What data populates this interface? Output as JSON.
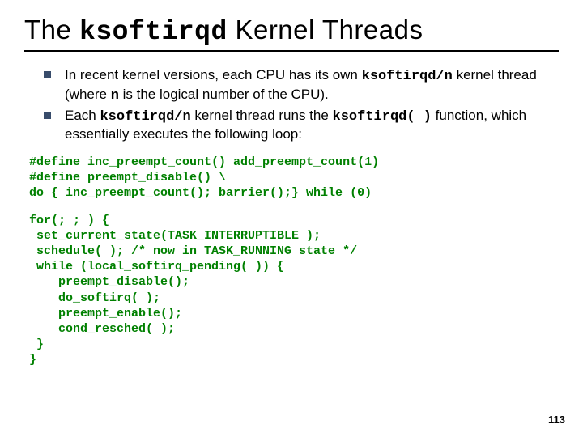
{
  "title": {
    "pre": "The ",
    "code": "ksoftirqd",
    "post": " Kernel Threads"
  },
  "bullets": [
    {
      "t1": "In recent kernel versions, each CPU has its own ",
      "c1": "ksoftirqd/n",
      "t2": " kernel thread (where ",
      "c2": "n",
      "t3": " is the logical number of the CPU)."
    },
    {
      "t1": "Each ",
      "c1": "ksoftirqd/n",
      "t2": " kernel thread runs the ",
      "c2": "ksoftirqd( )",
      "t3": " function, which essentially executes the following loop:"
    }
  ],
  "code1": "#define inc_preempt_count() add_preempt_count(1)\n#define preempt_disable() \\\ndo { inc_preempt_count(); barrier();} while (0)",
  "code2": "for(; ; ) {\n set_current_state(TASK_INTERRUPTIBLE );\n schedule( ); /* now in TASK_RUNNING state */\n while (local_softirq_pending( )) {\n    preempt_disable();\n    do_softirq( );\n    preempt_enable();\n    cond_resched( );\n }\n}",
  "page_number": "113"
}
